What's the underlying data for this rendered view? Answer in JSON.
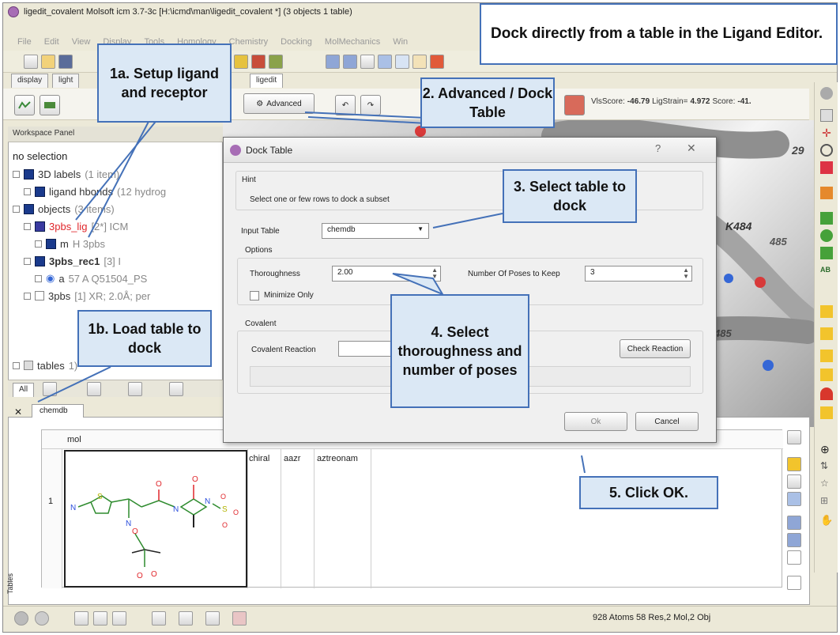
{
  "window": {
    "title": "ligedit_covalent Molsoft icm 3.7-3c  [H:\\icmd\\man\\ligedit_covalent *] (3 objects 1 table)"
  },
  "menu": {
    "items": [
      "File",
      "Edit",
      "View",
      "Display",
      "Tools",
      "Homology",
      "Chemistry",
      "Docking",
      "MolMechanics",
      "Win"
    ]
  },
  "tabs": {
    "items": [
      "display",
      "light",
      "ligedit"
    ]
  },
  "toolbar": {
    "advanced_label": "Advanced"
  },
  "scores": {
    "vls_label": "VlsScore:",
    "vls_value": "-46.79",
    "ligstrain_label": "LigStrain=",
    "ligstrain_value": "4.972",
    "score_label": "Score:",
    "score_value": "-41."
  },
  "workspace": {
    "title": "Workspace Panel",
    "selection": "no selection",
    "tree": [
      {
        "name": "3D labels",
        "extra": "(1 item)"
      },
      {
        "name": "ligand hbonds",
        "extra": "(12 hydrog"
      },
      {
        "name": "objects",
        "extra": "(3 items)"
      },
      {
        "name": "3pbs_lig",
        "extra": "[2*] ICM"
      },
      {
        "name": "m",
        "extra": "H  3pbs"
      },
      {
        "name": "3pbs_rec1",
        "extra": "[3] I"
      },
      {
        "name": "a",
        "extra": "57 A  Q51504_PS"
      },
      {
        "name": "3pbs",
        "extra": "[1] XR; 2.0Å; per"
      },
      {
        "name": "tables",
        "extra": "1)"
      }
    ],
    "tab_all": "All"
  },
  "viewer_labels": [
    "K484",
    "485",
    "485",
    "29"
  ],
  "dialog": {
    "title": "Dock Table",
    "hint_group": "Hint",
    "hint_text": "Select one or few rows to dock a subset",
    "input_table_label": "Input Table",
    "input_table_value": "chemdb",
    "options_group": "Options",
    "thoroughness_label": "Thoroughness",
    "thoroughness_value": "2.00",
    "poses_label": "Number Of Poses to Keep",
    "poses_value": "3",
    "minimize_label": "Minimize Only",
    "covalent_group": "Covalent",
    "covalent_label": "Covalent Reaction",
    "covalent_value": "",
    "check_reaction": "Check Reaction",
    "ok": "Ok",
    "cancel": "Cancel"
  },
  "table": {
    "tab": "chemdb",
    "columns": [
      "mol"
    ],
    "row_number": "1",
    "cells": [
      "chiral",
      "aazr",
      "aztreonam"
    ],
    "side_label": "Tables"
  },
  "status": {
    "text": "928 Atoms 58 Res,2 Mol,2 Obj"
  },
  "callouts": {
    "headline": "Dock directly from a table in the Ligand Editor.",
    "step1a": "1a. Setup ligand and receptor",
    "step1b": "1b. Load table to dock",
    "step2": "2. Advanced / Dock Table",
    "step3": "3. Select table to dock",
    "step4": "4. Select thoroughness and number of poses",
    "step5": "5. Click OK."
  },
  "colors": {
    "callout_fill": "#dbe8f5",
    "callout_border": "#4471b8",
    "red_object": "#e0262b",
    "atom_sulfur": "#b3b300",
    "atom_nitrogen": "#2a4ddc",
    "atom_oxygen": "#e0262b",
    "bond_green": "#2e8b2e"
  }
}
